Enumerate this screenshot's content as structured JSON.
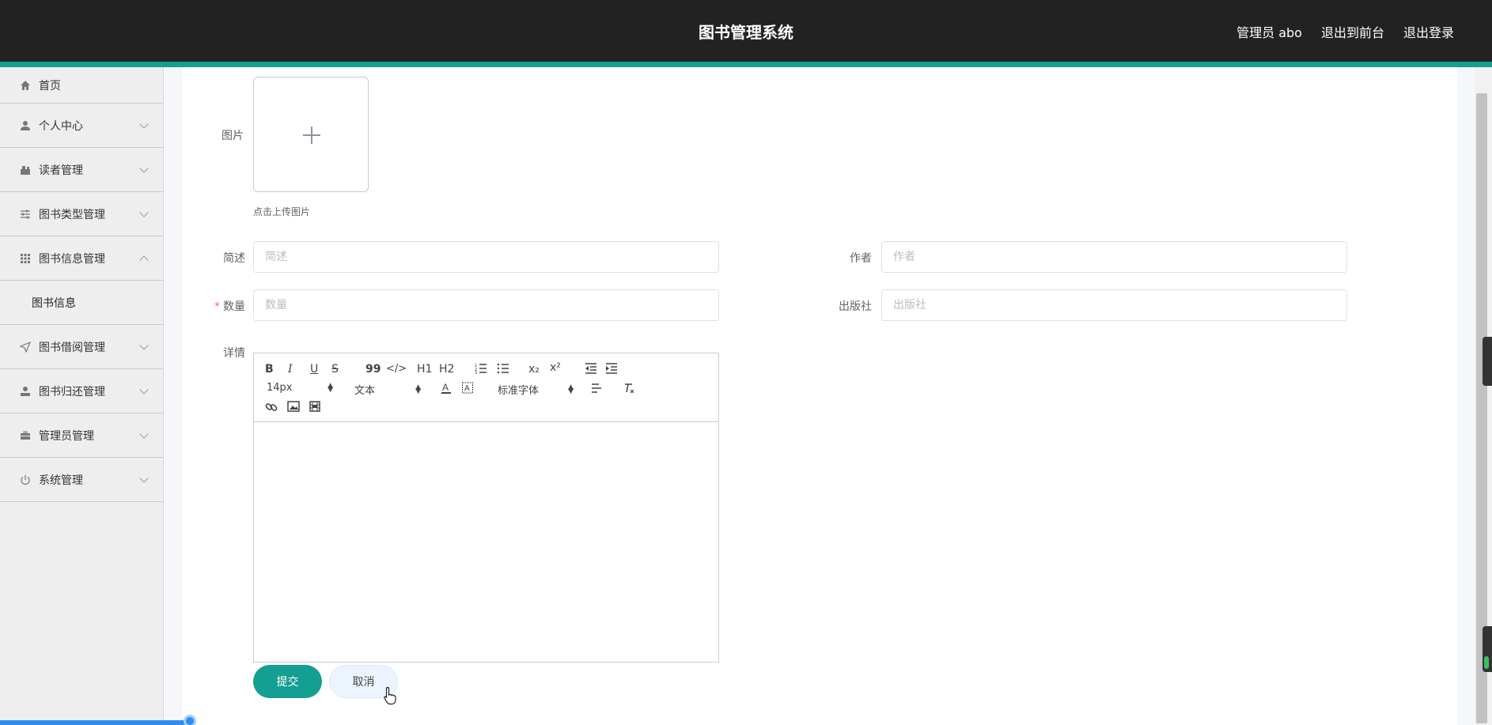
{
  "header": {
    "title": "图书管理系统",
    "user": "管理员 abo",
    "to_front": "退出到前台",
    "logout": "退出登录"
  },
  "sidebar": {
    "items": [
      {
        "label": "首页",
        "icon": "home-icon"
      },
      {
        "label": "个人中心",
        "icon": "user-icon"
      },
      {
        "label": "读者管理",
        "icon": "reader-icon"
      },
      {
        "label": "图书类型管理",
        "icon": "sliders-icon"
      },
      {
        "label": "图书信息管理",
        "icon": "grid-icon",
        "expanded": true
      },
      {
        "label": "图书借阅管理",
        "icon": "send-icon"
      },
      {
        "label": "图书归还管理",
        "icon": "user-return-icon"
      },
      {
        "label": "管理员管理",
        "icon": "briefcase-icon"
      },
      {
        "label": "系统管理",
        "icon": "power-icon"
      }
    ],
    "sub_item": "图书信息"
  },
  "form": {
    "image_label": "图片",
    "upload_tip": "点击上传图片",
    "summary_label": "简述",
    "summary_placeholder": "简述",
    "author_label": "作者",
    "author_placeholder": "作者",
    "quantity_required": "*",
    "quantity_label": "数量",
    "quantity_placeholder": "数量",
    "publisher_label": "出版社",
    "publisher_placeholder": "出版社",
    "detail_label": "详情"
  },
  "editor": {
    "bold": "B",
    "italic": "I",
    "underline": "U",
    "strike": "S",
    "blockquote": "99",
    "code": "</>",
    "h1": "H1",
    "h2": "H2",
    "sub": "x₂",
    "sup": "x²",
    "font_size": "14px",
    "header_select": "文本",
    "font_family": "标准字体"
  },
  "buttons": {
    "submit": "提交",
    "cancel": "取消"
  },
  "colors": {
    "accent": "#139f91",
    "header_bg": "#222222",
    "sidebar_bg": "#eeeeee"
  }
}
